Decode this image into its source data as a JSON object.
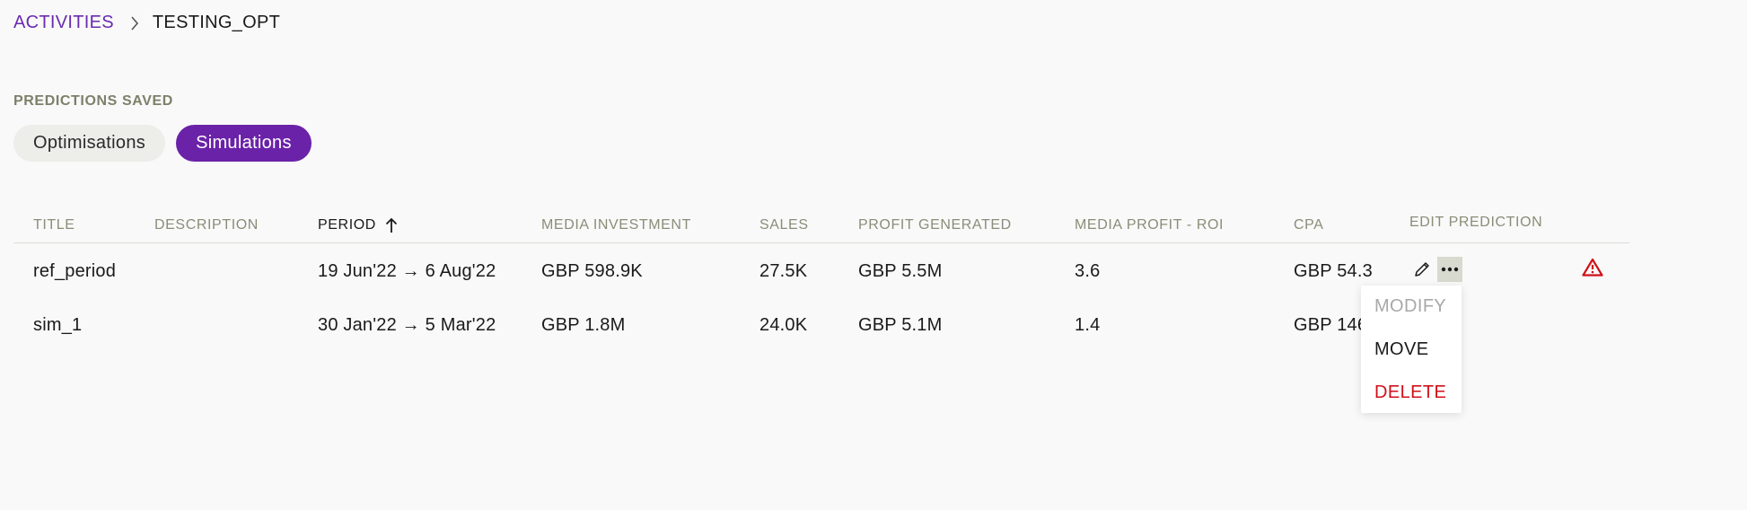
{
  "breadcrumb": {
    "parent": "ACTIVITIES",
    "current": "TESTING_OPT"
  },
  "section_label": "PREDICTIONS SAVED",
  "tabs": [
    {
      "label": "Optimisations",
      "active": false
    },
    {
      "label": "Simulations",
      "active": true
    }
  ],
  "table": {
    "headers": {
      "title": "TITLE",
      "description": "DESCRIPTION",
      "period": "PERIOD",
      "media_investment": "MEDIA INVESTMENT",
      "sales": "SALES",
      "profit_generated": "PROFIT GENERATED",
      "media_profit_roi": "MEDIA PROFIT - ROI",
      "cpa": "CPA",
      "edit_prediction": "EDIT PREDICTION"
    },
    "rows": [
      {
        "title": "ref_period",
        "description": "",
        "period": "19 Jun'22 → 6 Aug'22",
        "media_investment": "GBP 598.9K",
        "sales": "27.5K",
        "profit_generated": "GBP 5.5M",
        "roi": "3.6",
        "cpa": "GBP 54.3"
      },
      {
        "title": "sim_1",
        "description": "",
        "period": "30 Jan'22 → 5 Mar'22",
        "media_investment": "GBP 1.8M",
        "sales": "24.0K",
        "profit_generated": "GBP 5.1M",
        "roi": "1.4",
        "cpa": "GBP 146"
      }
    ]
  },
  "context_menu": {
    "modify": "MODIFY",
    "move": "MOVE",
    "delete": "DELETE"
  },
  "colors": {
    "accent": "#6a22a8",
    "danger": "#d0101a",
    "muted": "#8a8d78"
  }
}
